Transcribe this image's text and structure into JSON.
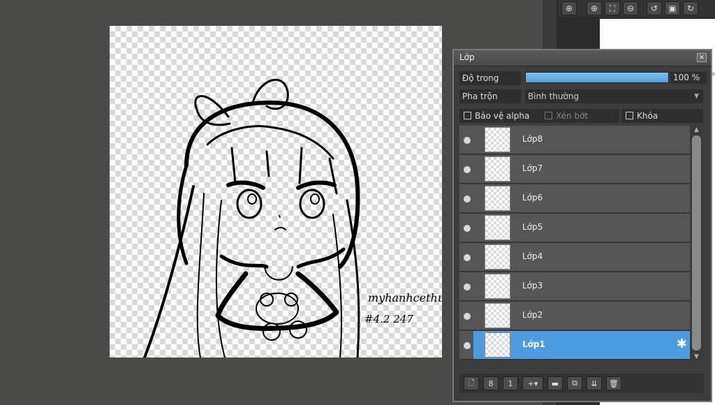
{
  "toolbar": {
    "icons": [
      "zoom-in-icon",
      "zoom-plus-icon",
      "fit-screen-icon",
      "zoom-minus-icon",
      "rotate-left-icon",
      "fullscreen-icon",
      "rotate-right-icon"
    ]
  },
  "canvas": {
    "signature_line1": "myhanhcethu",
    "signature_line2": "#4.2 247"
  },
  "layer_panel": {
    "title": "Lớp",
    "opacity_label": "Độ trong",
    "opacity_value": "100 %",
    "opacity_fraction": 1.0,
    "blend_label": "Pha trộn",
    "blend_value": "Bình thường",
    "protect_alpha_label": "Bảo vệ alpha",
    "clipping_label": "Xén bớt",
    "lock_label": "Khóa",
    "layers": [
      {
        "name": "Lớp8",
        "selected": false
      },
      {
        "name": "Lớp7",
        "selected": false
      },
      {
        "name": "Lớp6",
        "selected": false
      },
      {
        "name": "Lớp5",
        "selected": false
      },
      {
        "name": "Lớp4",
        "selected": false
      },
      {
        "name": "Lớp3",
        "selected": false
      },
      {
        "name": "Lớp2",
        "selected": false
      },
      {
        "name": "Lớp1",
        "selected": true
      }
    ]
  },
  "colors": {
    "selected_layer": "#4d9be0",
    "opacity_fill": "#6ab0e8",
    "background": "#4a4a48"
  }
}
